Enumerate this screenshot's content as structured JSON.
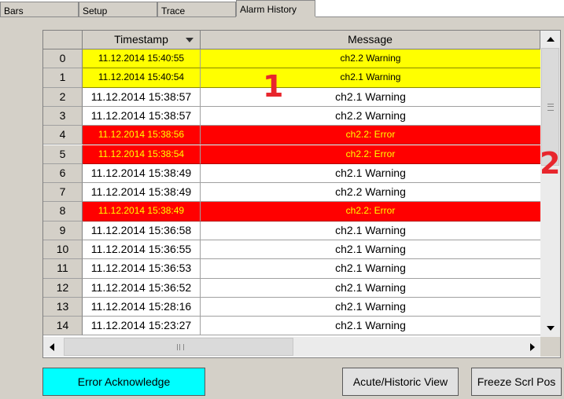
{
  "tabs": [
    {
      "label": "Bars"
    },
    {
      "label": "Setup"
    },
    {
      "label": "Trace"
    },
    {
      "label": "Alarm History",
      "active": true
    }
  ],
  "table": {
    "headers": {
      "index": "",
      "timestamp": "Timestamp",
      "message": "Message"
    },
    "sort_column": "timestamp",
    "rows": [
      {
        "index": "0",
        "timestamp": "11.12.2014 15:40:55",
        "message": "ch2.2 Warning",
        "status": "warn"
      },
      {
        "index": "1",
        "timestamp": "11.12.2014 15:40:54",
        "message": "ch2.1 Warning",
        "status": "warn"
      },
      {
        "index": "2",
        "timestamp": "11.12.2014 15:38:57",
        "message": "ch2.1 Warning",
        "status": "normal"
      },
      {
        "index": "3",
        "timestamp": "11.12.2014 15:38:57",
        "message": "ch2.2 Warning",
        "status": "normal"
      },
      {
        "index": "4",
        "timestamp": "11.12.2014 15:38:56",
        "message": "ch2.2: Error",
        "status": "err"
      },
      {
        "index": "5",
        "timestamp": "11.12.2014 15:38:54",
        "message": "ch2.2: Error",
        "status": "err"
      },
      {
        "index": "6",
        "timestamp": "11.12.2014 15:38:49",
        "message": "ch2.1 Warning",
        "status": "normal"
      },
      {
        "index": "7",
        "timestamp": "11.12.2014 15:38:49",
        "message": "ch2.2 Warning",
        "status": "normal"
      },
      {
        "index": "8",
        "timestamp": "11.12.2014 15:38:49",
        "message": "ch2.2: Error",
        "status": "err"
      },
      {
        "index": "9",
        "timestamp": "11.12.2014 15:36:58",
        "message": "ch2.1 Warning",
        "status": "normal"
      },
      {
        "index": "10",
        "timestamp": "11.12.2014 15:36:55",
        "message": "ch2.1 Warning",
        "status": "normal"
      },
      {
        "index": "11",
        "timestamp": "11.12.2014 15:36:53",
        "message": "ch2.1 Warning",
        "status": "normal"
      },
      {
        "index": "12",
        "timestamp": "11.12.2014 15:36:52",
        "message": "ch2.1 Warning",
        "status": "normal"
      },
      {
        "index": "13",
        "timestamp": "11.12.2014 15:28:16",
        "message": "ch2.1 Warning",
        "status": "normal"
      },
      {
        "index": "14",
        "timestamp": "11.12.2014 15:23:27",
        "message": "ch2.1 Warning",
        "status": "normal"
      }
    ]
  },
  "annotations": {
    "one": "1",
    "two": "2"
  },
  "buttons": {
    "error_ack": "Error Acknowledge",
    "view": "Acute/Historic View",
    "freeze": "Freeze Scrl Pos"
  },
  "colors": {
    "warning_bg": "#ffff00",
    "error_bg": "#ff0000",
    "error_text": "#ffff00",
    "acknowledge_button": "#00ffff",
    "annotation": "#e8262d"
  },
  "icons": {
    "sort": "chevron-down-icon",
    "scroll_up": "arrow-up-icon",
    "scroll_down": "arrow-down-icon",
    "scroll_left": "arrow-left-icon",
    "scroll_right": "arrow-right-icon"
  }
}
